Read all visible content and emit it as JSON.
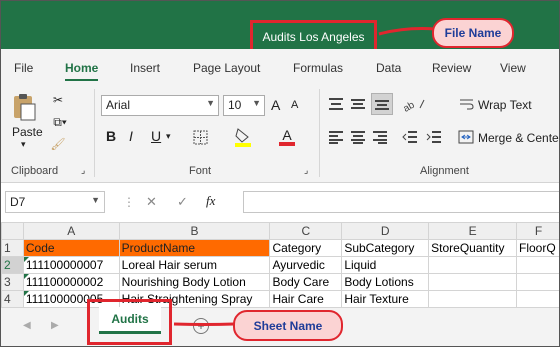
{
  "title_bar": {
    "file_name": "Audits Los Angeles"
  },
  "callouts": {
    "file_name": "File Name",
    "sheet_name": "Sheet Name"
  },
  "menu_tabs": [
    "File",
    "Home",
    "Insert",
    "Page Layout",
    "Formulas",
    "Data",
    "Review",
    "View"
  ],
  "active_tab": "Home",
  "ribbon": {
    "clipboard": {
      "label": "Clipboard",
      "paste_label": "Paste"
    },
    "font": {
      "label": "Font",
      "font_name": "Arial",
      "font_size": "10",
      "bold": "B",
      "italic": "I",
      "underline": "U",
      "grow": "A",
      "shrink": "A",
      "font_color": "A"
    },
    "alignment": {
      "label": "Alignment",
      "wrap_text": "Wrap Text",
      "merge_center": "Merge & Cente"
    }
  },
  "formula_bar": {
    "name_box": "D7",
    "fx": "fx",
    "formula": ""
  },
  "sheet": {
    "columns": [
      "A",
      "B",
      "C",
      "D",
      "E",
      "F"
    ],
    "selected_column": "D",
    "selected_row": "2",
    "rows": [
      {
        "num": "1",
        "cells": [
          "Code",
          "ProductName",
          "Category",
          "SubCategory",
          "StoreQuantity",
          "FloorQ"
        ]
      },
      {
        "num": "2",
        "cells": [
          "111100000007",
          "Loreal Hair serum",
          "Ayurvedic",
          "Liquid",
          "",
          ""
        ]
      },
      {
        "num": "3",
        "cells": [
          "111100000002",
          "Nourishing Body Lotion",
          "Body Care",
          "Body Lotions",
          "",
          ""
        ]
      },
      {
        "num": "4",
        "cells": [
          "111100000005",
          "Hair Straightening Spray",
          "Hair Care",
          "Hair Texture",
          "",
          ""
        ]
      }
    ]
  },
  "sheet_tabs": {
    "active": "Audits",
    "add_sheet_icon": "plus-circle-icon"
  },
  "colors": {
    "excel_green": "#217346",
    "header_orange": "#ff6a00",
    "callout_red": "#e0262e",
    "callout_fill": "#fbd3d3",
    "callout_text": "#1f3d99"
  }
}
